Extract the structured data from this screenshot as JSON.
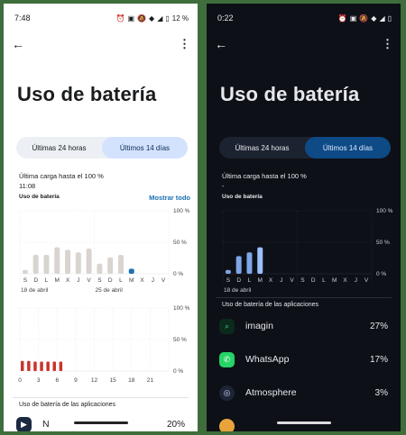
{
  "light": {
    "status_time": "7:48",
    "status_battery": "12 %",
    "title": "Uso de batería",
    "tab_24h": "Últimas 24 horas",
    "tab_14d": "Últimos 14 días",
    "charge_line1": "Última carga hasta el 100 %",
    "charge_line2": "11:08",
    "usage_label": "Uso de batería",
    "show_all": "Mostrar todo",
    "chart1": {
      "y_ticks": [
        "100 %",
        "50 %",
        "0 %"
      ],
      "day_labels": [
        "S",
        "D",
        "L",
        "M",
        "X",
        "J",
        "V",
        "S",
        "D",
        "L",
        "M",
        "X",
        "J",
        "V"
      ],
      "values": [
        6,
        30,
        30,
        42,
        38,
        34,
        40,
        16,
        26,
        30,
        8,
        0,
        0,
        0
      ],
      "date_labels": [
        "18 de abril",
        "25 de abril"
      ]
    },
    "chart2": {
      "y_ticks": [
        "100 %",
        "50 %",
        "0 %"
      ],
      "hour_labels": [
        "0",
        "3",
        "6",
        "9",
        "12",
        "15",
        "18",
        "21"
      ],
      "bars": [
        16,
        16,
        15,
        15,
        15,
        15,
        15
      ]
    },
    "apps_heading": "Uso de batería de las aplicaciones",
    "app_partial_name": "N",
    "app_partial_pct": "20%",
    "colors": {
      "bar": "#d9d4cf",
      "bar_active": "#1f6fb0",
      "bar_red": "#c9352b",
      "grid": "#e2e2e2"
    }
  },
  "dark": {
    "status_time": "0:22",
    "title": "Uso de batería",
    "tab_24h": "Últimas 24 horas",
    "tab_14d": "Últimos 14 días",
    "charge_line1": "Última carga hasta el 100 %",
    "charge_line2": "-",
    "usage_label": "Uso de batería",
    "chart": {
      "y_ticks": [
        "100 %",
        "50 %",
        "0 %"
      ],
      "day_labels": [
        "S",
        "D",
        "L",
        "M",
        "X",
        "J",
        "V",
        "S",
        "D",
        "L",
        "M",
        "X",
        "J",
        "V"
      ],
      "values": [
        6,
        28,
        34,
        42,
        0,
        0,
        0,
        0,
        0,
        0,
        0,
        0,
        0,
        0
      ],
      "date_label": "18 de abril"
    },
    "apps_heading": "Uso de batería de las aplicaciones",
    "apps": [
      {
        "name": "imagin",
        "pct": "27%",
        "icon": "search-icon"
      },
      {
        "name": "WhatsApp",
        "pct": "17%",
        "icon": "whatsapp-icon"
      },
      {
        "name": "Atmosphere",
        "pct": "3%",
        "icon": "atmosphere-icon"
      }
    ],
    "colors": {
      "bar": "#7ea6e6",
      "bar_active": "#9bc1ff",
      "grid": "#2b3242"
    }
  }
}
